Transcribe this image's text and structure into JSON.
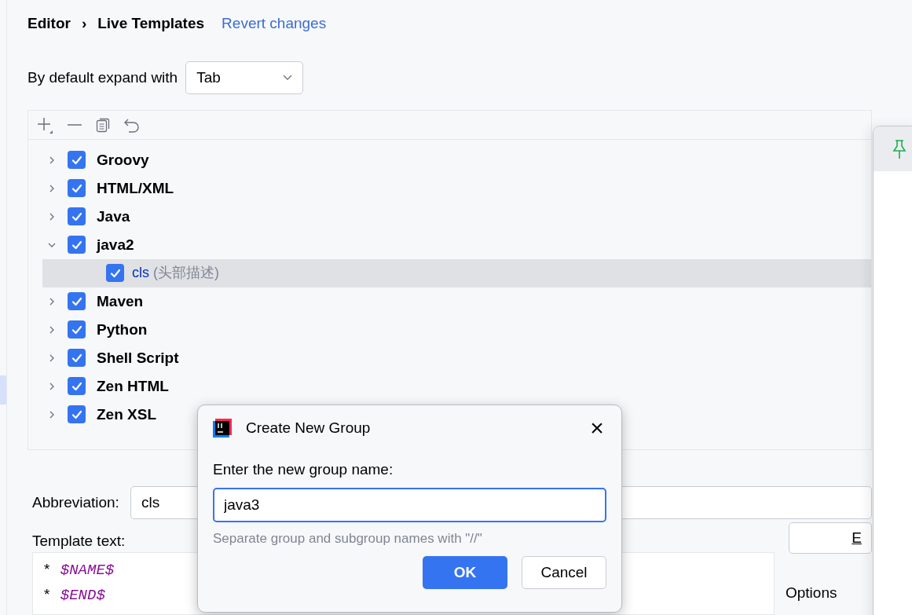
{
  "breadcrumb": {
    "parent": "Editor",
    "separator": "›",
    "current": "Live Templates",
    "link": "Revert changes"
  },
  "expand_with": {
    "label": "By default expand with",
    "value": "Tab"
  },
  "tree": [
    {
      "label": "Groovy",
      "checked": true,
      "expanded": false,
      "selected": false
    },
    {
      "label": "HTML/XML",
      "checked": true,
      "expanded": false,
      "selected": false
    },
    {
      "label": "Java",
      "checked": true,
      "expanded": false,
      "selected": false
    },
    {
      "label": "java2",
      "checked": true,
      "expanded": true,
      "selected": false,
      "children": [
        {
          "label": "cls",
          "description": "(头部描述)",
          "checked": true,
          "selected": true
        }
      ]
    },
    {
      "label": "Maven",
      "checked": true,
      "expanded": false,
      "selected": false
    },
    {
      "label": "Python",
      "checked": true,
      "expanded": false,
      "selected": false
    },
    {
      "label": "Shell Script",
      "checked": true,
      "expanded": false,
      "selected": false
    },
    {
      "label": "Zen HTML",
      "checked": true,
      "expanded": false,
      "selected": false
    },
    {
      "label": "Zen XSL",
      "checked": true,
      "expanded": false,
      "selected": false
    }
  ],
  "abbreviation": {
    "label": "Abbreviation:",
    "value": "cls"
  },
  "template_text": {
    "label": "Template text:",
    "lines": [
      "$NAME$",
      "$END$"
    ],
    "marker": "*"
  },
  "side_button": {
    "label": "E"
  },
  "options_label": "Options",
  "dialog": {
    "title": "Create New Group",
    "prompt": "Enter the new group name:",
    "value": "java3",
    "hint": "Separate group and subgroup names with \"//\"",
    "close": "×",
    "buttons": [
      {
        "label": "OK",
        "primary": true
      },
      {
        "label": "Cancel",
        "primary": false
      }
    ]
  }
}
